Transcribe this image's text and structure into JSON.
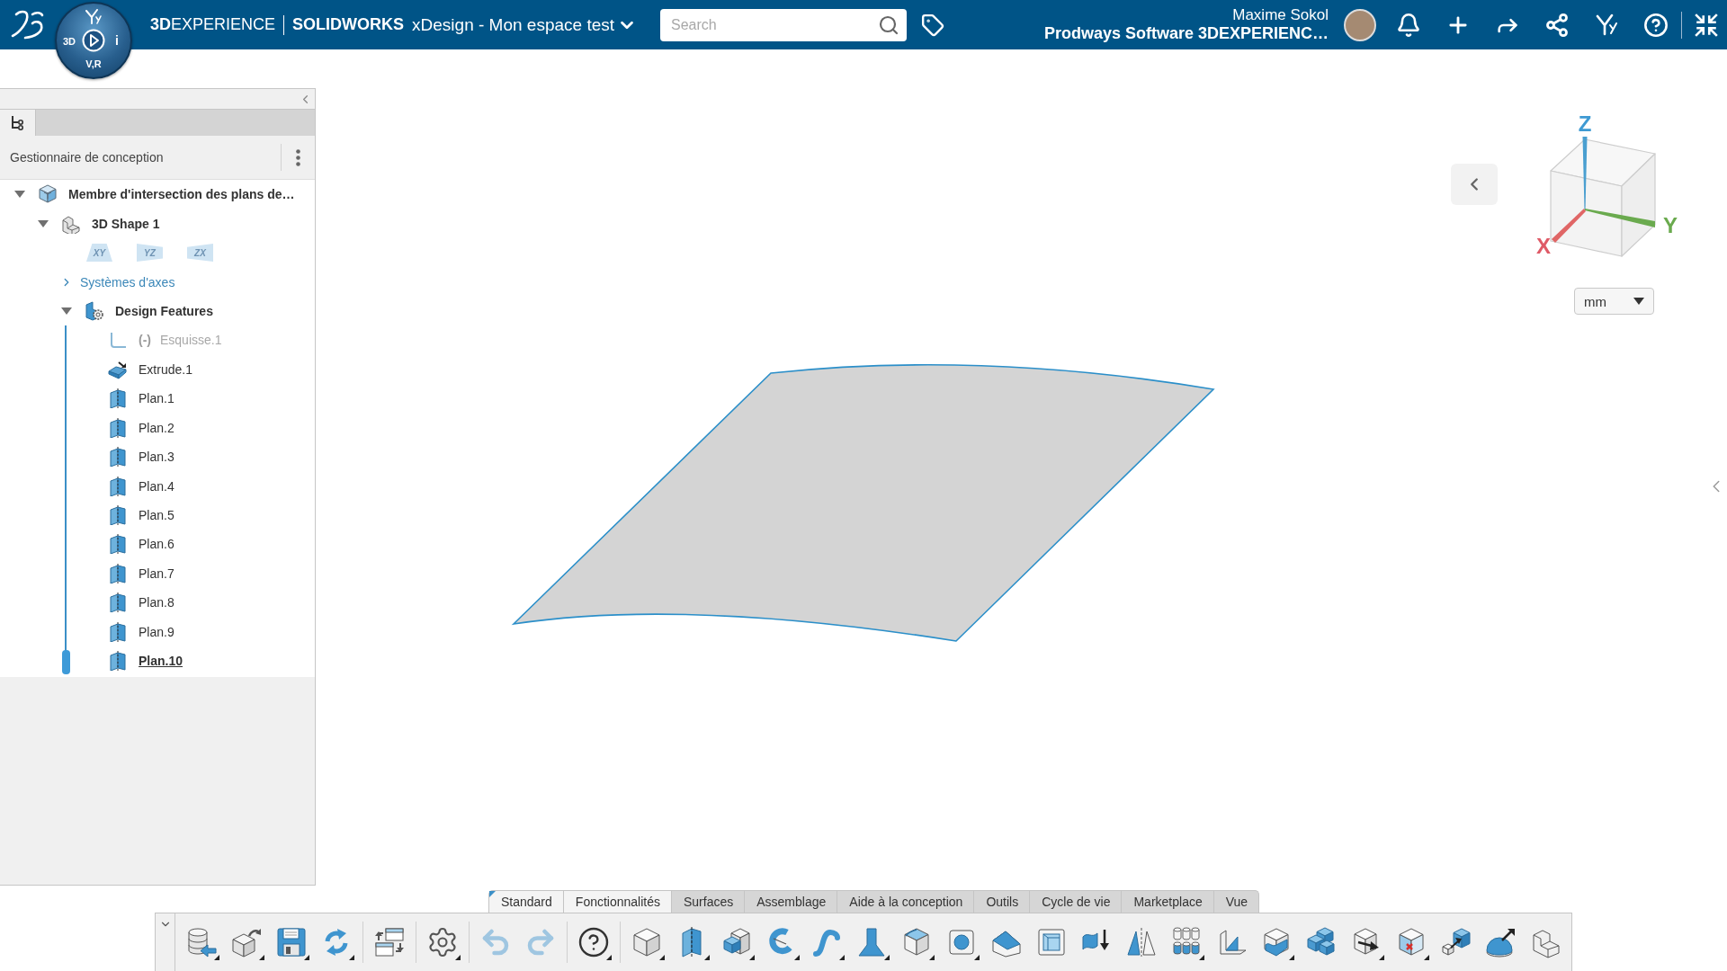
{
  "topbar": {
    "brand": "**3D**EXPERIENCE",
    "app": "SOLIDWORKS",
    "space": "xDesign - Mon espace test",
    "search": {
      "placeholder": "Search"
    },
    "user": "Maxime Sokol",
    "tenant": "Prodways Software 3DEXPERIENC…"
  },
  "compass": {
    "left": "3D",
    "right": "i",
    "bottom": "V,R"
  },
  "panel": {
    "title": "Gestionnaire de conception",
    "tree": [
      {
        "label": "Membre d'intersection des plans de…",
        "kind": "part",
        "expanded": true,
        "selected": false,
        "children": [
          {
            "label": "3D Shape 1",
            "kind": "shape",
            "expanded": true,
            "selected": false,
            "children": [
              {
                "kind": "planes",
                "planes": [
                  "XY",
                  "YZ",
                  "ZX"
                ]
              },
              {
                "label": "Systèmes d'axes",
                "kind": "axes",
                "expanded": false,
                "selected": false
              },
              {
                "label": "Design Features",
                "kind": "features",
                "expanded": true,
                "selected": false,
                "children": [
                  {
                    "label": "Esquisse.1",
                    "prefix": "(-)",
                    "kind": "sketch",
                    "suppressed": true,
                    "selected": false
                  },
                  {
                    "label": "Extrude.1",
                    "kind": "extrude",
                    "suppressed": false,
                    "selected": false
                  },
                  {
                    "label": "Plan.1",
                    "kind": "plane",
                    "suppressed": false,
                    "selected": false
                  },
                  {
                    "label": "Plan.2",
                    "kind": "plane",
                    "suppressed": false,
                    "selected": false
                  },
                  {
                    "label": "Plan.3",
                    "kind": "plane",
                    "suppressed": false,
                    "selected": false
                  },
                  {
                    "label": "Plan.4",
                    "kind": "plane",
                    "suppressed": false,
                    "selected": false
                  },
                  {
                    "label": "Plan.5",
                    "kind": "plane",
                    "suppressed": false,
                    "selected": false
                  },
                  {
                    "label": "Plan.6",
                    "kind": "plane",
                    "suppressed": false,
                    "selected": false
                  },
                  {
                    "label": "Plan.7",
                    "kind": "plane",
                    "suppressed": false,
                    "selected": false
                  },
                  {
                    "label": "Plan.8",
                    "kind": "plane",
                    "suppressed": false,
                    "selected": false
                  },
                  {
                    "label": "Plan.9",
                    "kind": "plane",
                    "suppressed": false,
                    "selected": false
                  },
                  {
                    "label": "Plan.10",
                    "kind": "plane",
                    "suppressed": false,
                    "selected": true
                  }
                ]
              }
            ]
          }
        ]
      }
    ]
  },
  "viewport": {
    "axes": {
      "x": "X",
      "y": "Y",
      "z": "Z"
    },
    "unit": "mm"
  },
  "action_bar": {
    "tabs": [
      {
        "label": "Standard",
        "selected": true,
        "pinned": true
      },
      {
        "label": "Fonctionnalités",
        "selected": true,
        "pinned": false
      },
      {
        "label": "Surfaces",
        "selected": false,
        "pinned": false
      },
      {
        "label": "Assemblage",
        "selected": false,
        "pinned": false
      },
      {
        "label": "Aide à la conception",
        "selected": false,
        "pinned": false
      },
      {
        "label": "Outils",
        "selected": false,
        "pinned": false
      },
      {
        "label": "Cycle de vie",
        "selected": false,
        "pinned": false
      },
      {
        "label": "Marketplace",
        "selected": false,
        "pinned": false
      },
      {
        "label": "Vue",
        "selected": false,
        "pinned": false
      }
    ],
    "groups": [
      [
        {
          "kind": "import",
          "menu": true,
          "disabled": false
        },
        {
          "kind": "part",
          "menu": true,
          "disabled": false
        },
        {
          "kind": "save",
          "menu": true,
          "disabled": false
        },
        {
          "kind": "refresh",
          "menu": true,
          "disabled": false
        }
      ],
      [
        {
          "kind": "swap",
          "menu": false,
          "disabled": false
        }
      ],
      [
        {
          "kind": "settings",
          "menu": true,
          "disabled": false
        }
      ],
      [
        {
          "kind": "undo",
          "menu": false,
          "disabled": true
        },
        {
          "kind": "redo",
          "menu": false,
          "disabled": true
        }
      ],
      [
        {
          "kind": "help",
          "menu": true,
          "disabled": false
        }
      ],
      [
        {
          "kind": "cube",
          "menu": true,
          "disabled": false
        },
        {
          "kind": "plane",
          "menu": true,
          "disabled": false
        },
        {
          "kind": "extrude",
          "menu": true,
          "disabled": false
        },
        {
          "kind": "revolve",
          "menu": true,
          "disabled": false
        },
        {
          "kind": "sweep",
          "menu": true,
          "disabled": false
        },
        {
          "kind": "loft",
          "menu": true,
          "disabled": false
        },
        {
          "kind": "fillet",
          "menu": true,
          "disabled": false
        },
        {
          "kind": "hole",
          "menu": true,
          "disabled": false
        },
        {
          "kind": "chamfer",
          "menu": false,
          "disabled": false
        },
        {
          "kind": "shell",
          "menu": false,
          "disabled": false
        },
        {
          "kind": "thicken",
          "menu": false,
          "disabled": false
        },
        {
          "kind": "mirror",
          "menu": false,
          "disabled": false
        },
        {
          "kind": "pattern",
          "menu": true,
          "disabled": false
        },
        {
          "kind": "rib",
          "menu": false,
          "disabled": false
        },
        {
          "kind": "split",
          "menu": true,
          "disabled": false
        },
        {
          "kind": "combine",
          "menu": false,
          "disabled": false
        },
        {
          "kind": "move",
          "menu": true,
          "disabled": false
        },
        {
          "kind": "delete",
          "menu": true,
          "disabled": false
        },
        {
          "kind": "scale",
          "menu": false,
          "disabled": false
        },
        {
          "kind": "dome",
          "menu": false,
          "disabled": false
        },
        {
          "kind": "block",
          "menu": false,
          "disabled": false
        }
      ]
    ]
  }
}
